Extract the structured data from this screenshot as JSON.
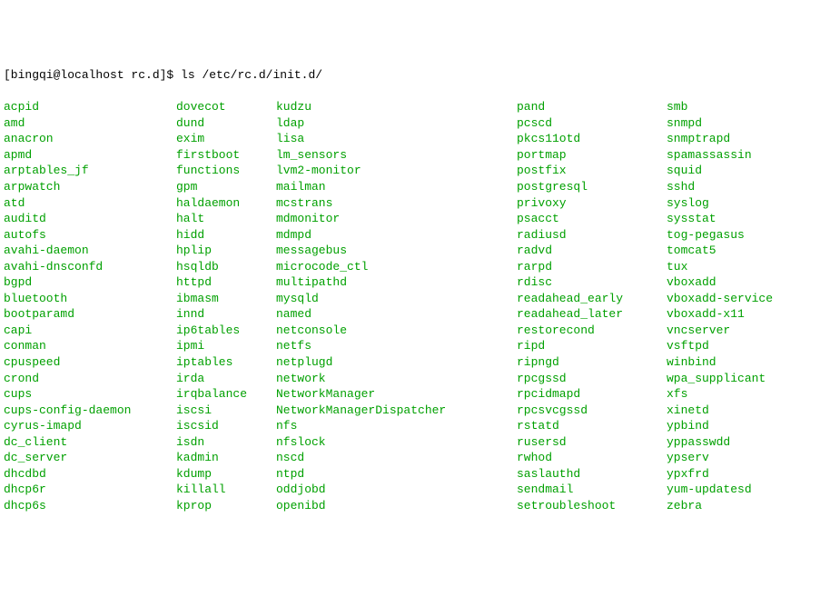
{
  "prompt": "[bingqi@localhost rc.d]$ ",
  "command": "ls /etc/rc.d/init.d/",
  "cols": {
    "c1": [
      "acpid",
      "amd",
      "anacron",
      "apmd",
      "arptables_jf",
      "arpwatch",
      "atd",
      "auditd",
      "autofs",
      "avahi-daemon",
      "avahi-dnsconfd",
      "bgpd",
      "bluetooth",
      "bootparamd",
      "capi",
      "conman",
      "cpuspeed",
      "crond",
      "cups",
      "cups-config-daemon",
      "cyrus-imapd",
      "dc_client",
      "dc_server",
      "dhcdbd",
      "dhcp6r",
      "dhcp6s"
    ],
    "c2": [
      "dovecot",
      "dund",
      "exim",
      "firstboot",
      "functions",
      "gpm",
      "haldaemon",
      "halt",
      "hidd",
      "hplip",
      "hsqldb",
      "httpd",
      "ibmasm",
      "innd",
      "ip6tables",
      "ipmi",
      "iptables",
      "irda",
      "irqbalance",
      "iscsi",
      "iscsid",
      "isdn",
      "kadmin",
      "kdump",
      "killall",
      "kprop"
    ],
    "c3": [
      "kudzu",
      "ldap",
      "lisa",
      "lm_sensors",
      "lvm2-monitor",
      "mailman",
      "mcstrans",
      "mdmonitor",
      "mdmpd",
      "messagebus",
      "microcode_ctl",
      "multipathd",
      "mysqld",
      "named",
      "netconsole",
      "netfs",
      "netplugd",
      "network",
      "NetworkManager",
      "NetworkManagerDispatcher",
      "nfs",
      "nfslock",
      "nscd",
      "ntpd",
      "oddjobd",
      "openibd"
    ],
    "c4": [
      "pand",
      "pcscd",
      "pkcs11otd",
      "portmap",
      "postfix",
      "postgresql",
      "privoxy",
      "psacct",
      "radiusd",
      "radvd",
      "rarpd",
      "rdisc",
      "readahead_early",
      "readahead_later",
      "restorecond",
      "ripd",
      "ripngd",
      "rpcgssd",
      "rpcidmapd",
      "rpcsvcgssd",
      "rstatd",
      "rusersd",
      "rwhod",
      "saslauthd",
      "sendmail",
      "setroubleshoot"
    ],
    "c5": [
      "smb",
      "snmpd",
      "snmptrapd",
      "spamassassin",
      "squid",
      "sshd",
      "syslog",
      "sysstat",
      "tog-pegasus",
      "tomcat5",
      "tux",
      "vboxadd",
      "vboxadd-service",
      "vboxadd-x11",
      "vncserver",
      "vsftpd",
      "winbind",
      "wpa_supplicant",
      "xfs",
      "xinetd",
      "ypbind",
      "yppasswdd",
      "ypserv",
      "ypxfrd",
      "yum-updatesd",
      "zebra"
    ]
  }
}
